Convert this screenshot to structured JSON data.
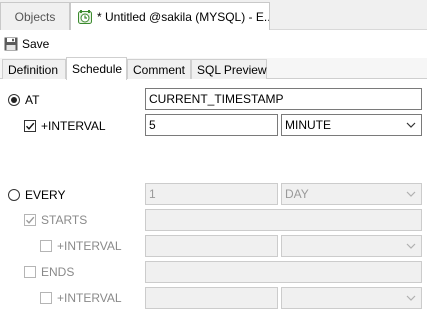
{
  "doc_tabs": [
    {
      "label": "Objects"
    },
    {
      "label": "* Untitled @sakila (MYSQL) - E..."
    }
  ],
  "toolbar": {
    "save_label": "Save"
  },
  "sub_tabs": [
    {
      "label": "Definition"
    },
    {
      "label": "Schedule"
    },
    {
      "label": "Comment"
    },
    {
      "label": "SQL Preview"
    }
  ],
  "schedule": {
    "at": {
      "label": "AT",
      "value": "CURRENT_TIMESTAMP",
      "selected": true
    },
    "at_interval": {
      "label": "+INTERVAL",
      "checked": true,
      "amount": "5",
      "unit": "MINUTE"
    },
    "every": {
      "label": "EVERY",
      "selected": false,
      "amount": "1",
      "unit": "DAY"
    },
    "starts": {
      "label": "STARTS",
      "checked": true,
      "value": ""
    },
    "starts_interval": {
      "label": "+INTERVAL",
      "checked": false,
      "amount": "",
      "unit": ""
    },
    "ends": {
      "label": "ENDS",
      "checked": false,
      "value": ""
    },
    "ends_interval": {
      "label": "+INTERVAL",
      "checked": false,
      "amount": "",
      "unit": ""
    }
  }
}
